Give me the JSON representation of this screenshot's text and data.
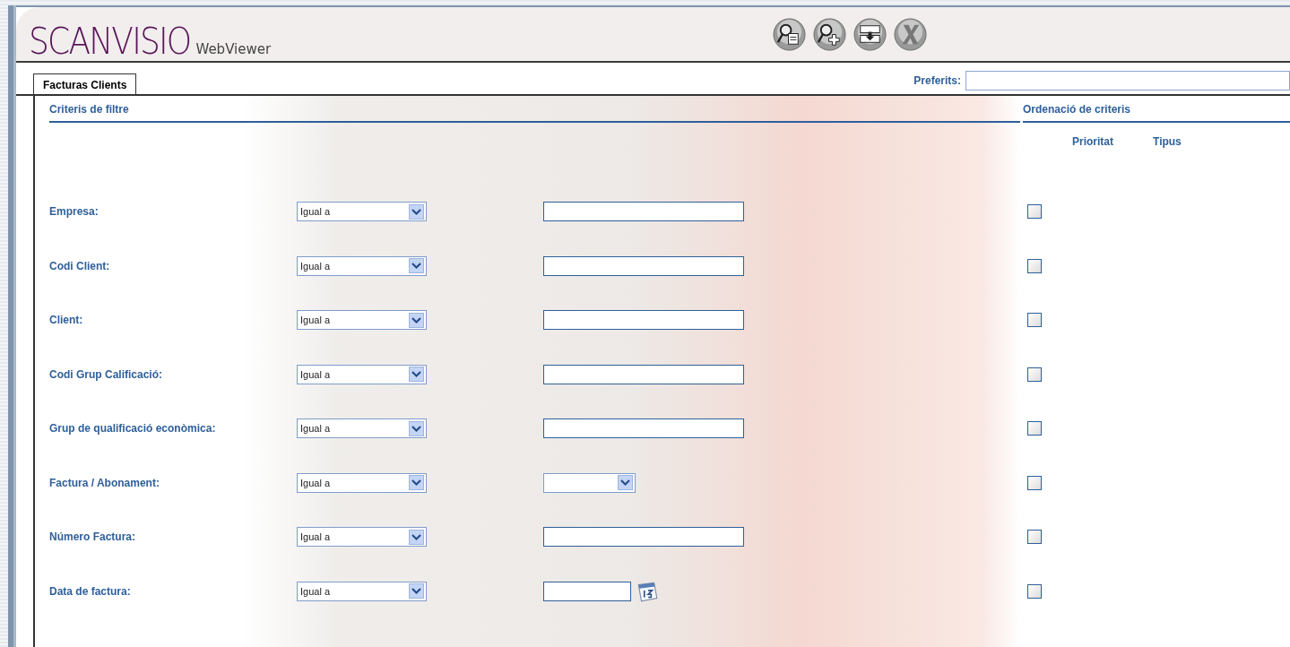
{
  "header": {
    "logo": "SCANVISIO",
    "logo_suffix": "WebViewer",
    "toolbar": [
      {
        "kind": "search-document"
      },
      {
        "kind": "search-add"
      },
      {
        "kind": "tray"
      },
      {
        "kind": "close"
      }
    ]
  },
  "tabs": [
    {
      "label": "Facturas Clients",
      "selected": true
    }
  ],
  "favorites": {
    "label": "Preferits:"
  },
  "filter": {
    "title": "Criteris de filtre"
  },
  "ordering": {
    "title": "Ordenació de criteris",
    "columns": [
      "Prioritat",
      "Tipus"
    ]
  },
  "rows": [
    {
      "label": "Empresa:",
      "operator": "Igual a",
      "kind": "text",
      "checked": false
    },
    {
      "label": "Codi Client:",
      "operator": "Igual a",
      "kind": "text",
      "checked": false
    },
    {
      "label": "Client:",
      "operator": "Igual a",
      "kind": "text",
      "checked": false
    },
    {
      "label": "Codi Grup Calificació:",
      "operator": "Igual a",
      "kind": "text",
      "checked": false
    },
    {
      "label": "Grup de qualificació econòmica:",
      "operator": "Igual a",
      "kind": "text",
      "checked": false
    },
    {
      "label": "Factura / Abonament:",
      "operator": "Igual a",
      "kind": "select",
      "checked": false
    },
    {
      "label": "Número Factura:",
      "operator": "Igual a",
      "kind": "text",
      "checked": false
    },
    {
      "label": "Data de factura:",
      "operator": "Igual a",
      "kind": "date",
      "checked": false
    }
  ]
}
